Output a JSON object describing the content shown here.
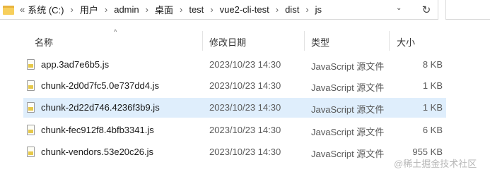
{
  "address_bar": {
    "lead": "«",
    "path": [
      "系统 (C:)",
      "用户",
      "admin",
      "桌面",
      "test",
      "vue2-cli-test",
      "dist",
      "js"
    ],
    "dropdown_icon": "chevron-down-icon",
    "refresh_icon": "refresh-icon"
  },
  "columns": {
    "name": "名称",
    "date": "修改日期",
    "type": "类型",
    "size": "大小"
  },
  "sort": {
    "column": "name",
    "direction": "ascending",
    "glyph": "^"
  },
  "files": [
    {
      "name": "app.3ad7e6b5.js",
      "date": "2023/10/23 14:30",
      "type": "JavaScript 源文件",
      "size": "8 KB",
      "selected": false
    },
    {
      "name": "chunk-2d0d7fc5.0e737dd4.js",
      "date": "2023/10/23 14:30",
      "type": "JavaScript 源文件",
      "size": "1 KB",
      "selected": false
    },
    {
      "name": "chunk-2d22d746.4236f3b9.js",
      "date": "2023/10/23 14:30",
      "type": "JavaScript 源文件",
      "size": "1 KB",
      "selected": true
    },
    {
      "name": "chunk-fec912f8.4bfb3341.js",
      "date": "2023/10/23 14:30",
      "type": "JavaScript 源文件",
      "size": "6 KB",
      "selected": false
    },
    {
      "name": "chunk-vendors.53e20c26.js",
      "date": "2023/10/23 14:30",
      "type": "JavaScript 源文件",
      "size": "955 KB",
      "selected": false
    }
  ],
  "watermark": "@稀土掘金技术社区",
  "colors": {
    "selected_row": "#dfeefc",
    "folder": "#f7cf5c",
    "js_tag": "#e6c84a"
  }
}
